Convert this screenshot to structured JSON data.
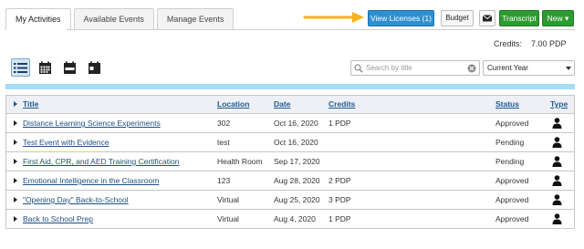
{
  "tabs": [
    {
      "label": "My Activities",
      "active": true
    },
    {
      "label": "Available Events",
      "active": false
    },
    {
      "label": "Manage Events",
      "active": false
    }
  ],
  "toolbar": {
    "view_licenses_label": "View Licenses (1)",
    "budget_label": "Budget",
    "transcript_label": "Transcript",
    "new_label": "New ▾"
  },
  "credits": {
    "label": "Credits:",
    "value": "7.00 PDP"
  },
  "view_modes": [
    "list-view-icon",
    "calendar-month-icon",
    "calendar-week-icon",
    "calendar-day-icon"
  ],
  "search": {
    "placeholder": "Search by title",
    "value": ""
  },
  "filter": {
    "selected": "Current Year"
  },
  "table": {
    "headers": {
      "title": "Title",
      "location": "Location",
      "date": "Date",
      "credits": "Credits",
      "status": "Status",
      "type": "Type"
    },
    "rows": [
      {
        "title": "Distance Learning Science Experiments",
        "location": "302",
        "date": "Oct 16, 2020",
        "credits": "1 PDP",
        "status": "Approved",
        "type_icon": "person-icon"
      },
      {
        "title": "Test Event with Evidence",
        "location": "test",
        "date": "Oct 16, 2020",
        "credits": "",
        "status": "Pending",
        "type_icon": "person-icon"
      },
      {
        "title": "First Aid, CPR, and AED Training Certification",
        "location": "Health Room",
        "date": "Sep 17, 2020",
        "credits": "",
        "status": "Pending",
        "type_icon": "person-icon"
      },
      {
        "title": "Emotional Intelligence in the Classroom",
        "location": "123",
        "date": "Aug 28, 2020",
        "credits": "2 PDP",
        "status": "Approved",
        "type_icon": "person-icon"
      },
      {
        "title": "\"Opening Day\" Back-to-School",
        "location": "Virtual",
        "date": "Aug 25, 2020",
        "credits": "3 PDP",
        "status": "Approved",
        "type_icon": "person-icon"
      },
      {
        "title": "Back to School Prep",
        "location": "Virtual",
        "date": "Aug 4, 2020",
        "credits": "1 PDP",
        "status": "Approved",
        "type_icon": "person-icon"
      }
    ]
  },
  "colors": {
    "accent_blue": "#2f8fd1",
    "green": "#2e9b32",
    "arrow": "#f5b21b",
    "bar": "#a6dcf4",
    "link": "#1d4f80"
  }
}
